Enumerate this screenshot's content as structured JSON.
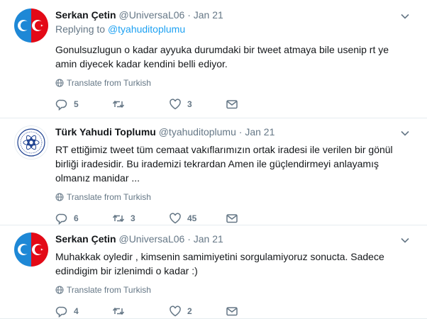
{
  "tweets": [
    {
      "name": "Serkan Çetin",
      "handle": "@UniversaL06",
      "separator": "·",
      "time": "Jan 21",
      "replying_prefix": "Replying to",
      "replying_to": "@tyahuditoplumu",
      "text": "Gonulsuzlugun o kadar ayyuka durumdaki bir tweet atmaya bile usenip rt ye amin diyecek kadar kendini belli ediyor.",
      "translate": "Translate from Turkish",
      "replies": "5",
      "retweets": "",
      "likes": "3"
    },
    {
      "name": "Türk Yahudi Toplumu",
      "handle": "@tyahuditoplumu",
      "separator": "·",
      "time": "Jan 21",
      "text": "RT ettiğimiz tweet tüm cemaat vakıflarımızın ortak iradesi ile verilen bir gönül birliği iradesidir. Bu irademizi tekrardan Amen ile güçlendirmeyi anlayamış olmanız manidar ...",
      "translate": "Translate from Turkish",
      "replies": "6",
      "retweets": "3",
      "likes": "45"
    },
    {
      "name": "Serkan Çetin",
      "handle": "@UniversaL06",
      "separator": "·",
      "time": "Jan 21",
      "text": "Muhakkak oyledir , kimsenin samimiyetini sorgulamiyoruz sonucta. Sadece edindigim bir izlenimdi o kadar :)",
      "translate": "Translate from Turkish",
      "replies": "4",
      "retweets": "",
      "likes": "2"
    }
  ],
  "colors": {
    "link": "#1da1f2",
    "muted": "#657786",
    "text": "#14171a",
    "divider": "#e6ecf0"
  },
  "icons": [
    "caret-down-icon",
    "globe-icon",
    "reply-icon",
    "retweet-icon",
    "like-icon",
    "dm-icon",
    "avatar-flag",
    "avatar-logo"
  ]
}
